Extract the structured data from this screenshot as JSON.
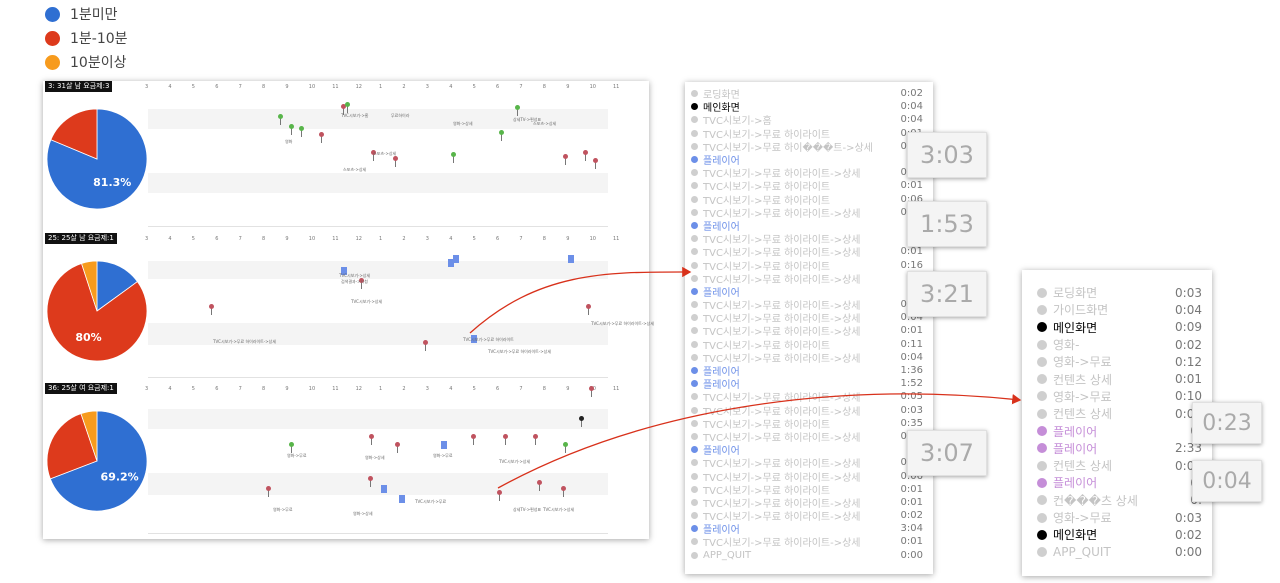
{
  "legend": [
    {
      "label": "1분미만",
      "color": "#2f6fd2"
    },
    {
      "label": "1분-10분",
      "color": "#dd3a1c"
    },
    {
      "label": "10분이상",
      "color": "#f79b1d"
    }
  ],
  "axis_ticks": [
    "3",
    "4",
    "5",
    "6",
    "7",
    "8",
    "9",
    "10",
    "11",
    "12",
    "1",
    "2",
    "3",
    "4",
    "5",
    "6",
    "7",
    "8",
    "9",
    "10",
    "11"
  ],
  "chart_data": [
    {
      "type": "pie",
      "title": "3: 31살 남 요금제:3",
      "label": "81.3%",
      "slices": [
        {
          "name": "1분미만",
          "value": 81.3,
          "color": "#2f6fd2"
        },
        {
          "name": "1분-10분",
          "value": 18.7,
          "color": "#dd3a1c"
        },
        {
          "name": "10분이상",
          "value": 0,
          "color": "#f79b1d"
        }
      ]
    },
    {
      "type": "pie",
      "title": "25: 25살 남 요금제:1",
      "label": "80%",
      "slices": [
        {
          "name": "1분미만",
          "value": 15,
          "color": "#2f6fd2"
        },
        {
          "name": "1분-10분",
          "value": 80,
          "color": "#dd3a1c"
        },
        {
          "name": "10분이상",
          "value": 5,
          "color": "#f79b1d"
        }
      ]
    },
    {
      "type": "pie",
      "title": "36: 25살 여 요금제:1",
      "label": "69.2%",
      "slices": [
        {
          "name": "1분미만",
          "value": 69.2,
          "color": "#2f6fd2"
        },
        {
          "name": "1분-10분",
          "value": 25.6,
          "color": "#dd3a1c"
        },
        {
          "name": "10분이상",
          "value": 5.2,
          "color": "#f79b1d"
        }
      ]
    }
  ],
  "timeline_notes": [
    [
      "TVC시보기->홈",
      "무료하이라",
      "영화->상세",
      "스포츠->상세",
      "영화",
      "스포츠->상세",
      "상세TV->편성표",
      "스포츠->상세"
    ],
    [
      "검색결과->시청",
      "TVC시보기->상세",
      "TVC시보기->무료 하이라이트->상세",
      "TVC시보기->무료 하이라이트",
      "TVC시보기->무료 하이라이트->상세",
      "TVC시보기->무료 하이라이트->상세",
      "TVC시보기->상세"
    ],
    [
      "영화->무료",
      "영화->상세",
      "영화->무료",
      "TVC시보기->상세",
      "TVC시보기->무료",
      "영화->무료",
      "영화->상세",
      "상세TV->편성표",
      "TVC시보기->상세"
    ]
  ],
  "log1": {
    "rows": [
      {
        "label": "로딩화면",
        "time": "0:02",
        "type": "gray"
      },
      {
        "label": "메인화면",
        "time": "0:04",
        "type": "black"
      },
      {
        "label": "TVC시보기->홈",
        "time": "0:04",
        "type": "gray"
      },
      {
        "label": "TVC시보기->무료 하이라이트",
        "time": "0:01",
        "type": "gray"
      },
      {
        "label": "TVC시보기->무료 하이���트->상세",
        "time": "0:01",
        "type": "gray"
      },
      {
        "label": "플레이어",
        "time": "",
        "type": "blue"
      },
      {
        "label": "TVC시보기->무료 하이라이트->상세",
        "time": "0:03",
        "type": "gray"
      },
      {
        "label": "TVC시보기->무료 하이라이트",
        "time": "0:01",
        "type": "gray"
      },
      {
        "label": "TVC시보기->무료 하이라이트",
        "time": "0:06",
        "type": "gray"
      },
      {
        "label": "TVC시보기->무료 하이라이트->상세",
        "time": "0:06",
        "type": "gray"
      },
      {
        "label": "플레이어",
        "time": "1",
        "type": "blue"
      },
      {
        "label": "TVC시보기->무료 하이라이트->상세",
        "time": "0:",
        "type": "gray"
      },
      {
        "label": "TVC시보기->무료 하이라이트->상세",
        "time": "0:01",
        "type": "gray"
      },
      {
        "label": "TVC시보기->무료 하이라이트",
        "time": "0:16",
        "type": "gray"
      },
      {
        "label": "TVC시보기->무료 하이라이트->상세",
        "time": "0:",
        "type": "gray"
      },
      {
        "label": "플레이어",
        "time": "",
        "type": "blue"
      },
      {
        "label": "TVC시보기->무료 하이라이트->상세",
        "time": "0:03",
        "type": "gray"
      },
      {
        "label": "TVC시보기->무료 하이라이트->상세",
        "time": "0:04",
        "type": "gray"
      },
      {
        "label": "TVC시보기->무료 하이라이트->상세",
        "time": "0:01",
        "type": "gray"
      },
      {
        "label": "TVC시보기->무료 하이라이트",
        "time": "0:11",
        "type": "gray"
      },
      {
        "label": "TVC시보기->무료 하이라이트->상세",
        "time": "0:04",
        "type": "gray"
      },
      {
        "label": "플레이어",
        "time": "1:36",
        "type": "blue"
      },
      {
        "label": "플레이어",
        "time": "1:52",
        "type": "blue"
      },
      {
        "label": "TVC시보기->무료 하이라이트->상세",
        "time": "0:05",
        "type": "gray"
      },
      {
        "label": "TVC시보기->무료 하이라이트->상세",
        "time": "0:03",
        "type": "gray"
      },
      {
        "label": "TVC시보기->무료 하이라이트",
        "time": "0:35",
        "type": "gray"
      },
      {
        "label": "TVC시보기->무료 하이라이트->상세",
        "time": "0:01",
        "type": "gray"
      },
      {
        "label": "플레이어",
        "time": "",
        "type": "blue"
      },
      {
        "label": "TVC시보기->무료 하이라이트->상세",
        "time": "0:05",
        "type": "gray"
      },
      {
        "label": "TVC시보기->무료 하이라이트->상세",
        "time": "0:06",
        "type": "gray"
      },
      {
        "label": "TVC시보기->무료 하이라이트",
        "time": "0:01",
        "type": "gray"
      },
      {
        "label": "TVC시보기->무료 하이라이트->상세",
        "time": "0:01",
        "type": "gray"
      },
      {
        "label": "TVC시보기->무료 하이라이트->상세",
        "time": "0:02",
        "type": "gray"
      },
      {
        "label": "플레이어",
        "time": "3:04",
        "type": "blue"
      },
      {
        "label": "TVC시보기->무료 하이라이트->상세",
        "time": "0:01",
        "type": "gray"
      },
      {
        "label": "APP_QUIT",
        "time": "0:00",
        "type": "gray"
      }
    ]
  },
  "log2": {
    "rows": [
      {
        "label": "로딩화면",
        "time": "0:03",
        "type": "gray"
      },
      {
        "label": "가이드화면",
        "time": "0:04",
        "type": "gray"
      },
      {
        "label": "메인화면",
        "time": "0:09",
        "type": "black"
      },
      {
        "label": "영화-",
        "time": "0:02",
        "type": "gray"
      },
      {
        "label": "영화->무료",
        "time": "0:12",
        "type": "gray"
      },
      {
        "label": "컨텐츠 상세",
        "time": "0:01",
        "type": "gray"
      },
      {
        "label": "영화->무료",
        "time": "0:10",
        "type": "gray"
      },
      {
        "label": "컨텐츠 상세",
        "time": "0:01",
        "type": "gray"
      },
      {
        "label": "플레이어",
        "time": "0:",
        "type": "purple"
      },
      {
        "label": "플레이어",
        "time": "2:33",
        "type": "purple"
      },
      {
        "label": "컨텐츠 상세",
        "time": "0:01",
        "type": "gray"
      },
      {
        "label": "플레이어",
        "time": "0:",
        "type": "purple"
      },
      {
        "label": "컨���츠 상세",
        "time": "0:",
        "type": "gray"
      },
      {
        "label": "영화->무료",
        "time": "0:03",
        "type": "gray"
      },
      {
        "label": "메인화면",
        "time": "0:02",
        "type": "black"
      },
      {
        "label": "APP_QUIT",
        "time": "0:00",
        "type": "gray"
      }
    ]
  },
  "badges": {
    "b1": "3:03",
    "b2": "1:53",
    "b3": "3:21",
    "b4": "3:07",
    "b5": "0:23",
    "b6": "0:04"
  },
  "colors": {
    "gray": "#cfcfcf",
    "black": "#000000",
    "blue": "#6c8fe8",
    "purple": "#c58ed8"
  }
}
